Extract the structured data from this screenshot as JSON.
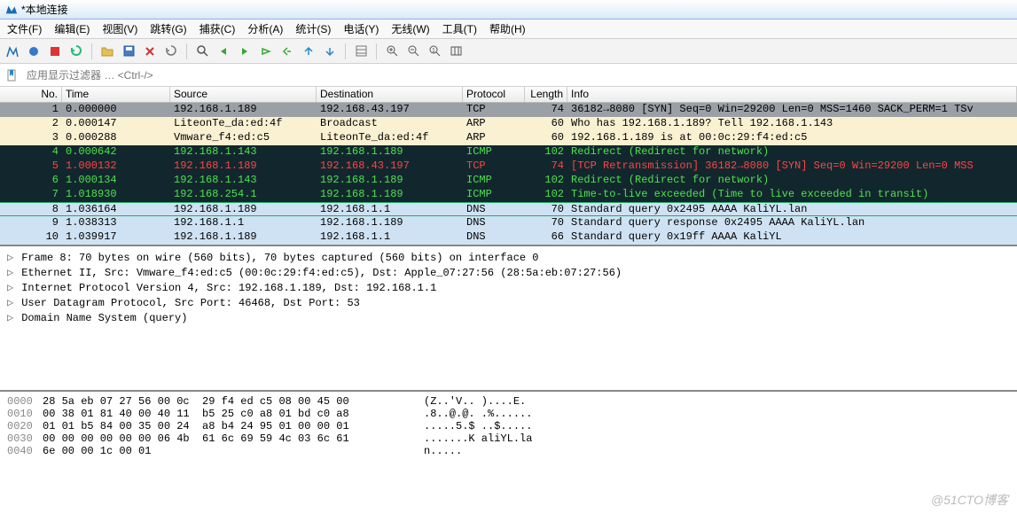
{
  "title": "*本地连接",
  "menu": [
    "文件(F)",
    "编辑(E)",
    "视图(V)",
    "跳转(G)",
    "捕获(C)",
    "分析(A)",
    "统计(S)",
    "电话(Y)",
    "无线(W)",
    "工具(T)",
    "帮助(H)"
  ],
  "filter_placeholder": "应用显示过滤器 … <Ctrl-/>",
  "columns": [
    "No.",
    "Time",
    "Source",
    "Destination",
    "Protocol",
    "Length",
    "Info"
  ],
  "packets": [
    {
      "no": "1",
      "time": "0.000000",
      "src": "192.168.1.189",
      "dst": "192.168.43.197",
      "proto": "TCP",
      "len": "74",
      "info": "36182→8080 [SYN] Seq=0 Win=29200 Len=0 MSS=1460 SACK_PERM=1 TSv",
      "bg": "#9aa0a6",
      "fg": "#000"
    },
    {
      "no": "2",
      "time": "0.000147",
      "src": "LiteonTe_da:ed:4f",
      "dst": "Broadcast",
      "proto": "ARP",
      "len": "60",
      "info": "Who has 192.168.1.189? Tell 192.168.1.143",
      "bg": "#faf0d2",
      "fg": "#000"
    },
    {
      "no": "3",
      "time": "0.000288",
      "src": "Vmware_f4:ed:c5",
      "dst": "LiteonTe_da:ed:4f",
      "proto": "ARP",
      "len": "60",
      "info": "192.168.1.189 is at 00:0c:29:f4:ed:c5",
      "bg": "#faf0d2",
      "fg": "#000"
    },
    {
      "no": "4",
      "time": "0.000642",
      "src": "192.168.1.143",
      "dst": "192.168.1.189",
      "proto": "ICMP",
      "len": "102",
      "info": "Redirect               (Redirect for network)",
      "bg": "#12272d",
      "fg": "#4de24d"
    },
    {
      "no": "5",
      "time": "1.000132",
      "src": "192.168.1.189",
      "dst": "192.168.43.197",
      "proto": "TCP",
      "len": "74",
      "info": "[TCP Retransmission] 36182→8080 [SYN] Seq=0 Win=29200 Len=0 MSS",
      "bg": "#12272d",
      "fg": "#ff4444"
    },
    {
      "no": "6",
      "time": "1.000134",
      "src": "192.168.1.143",
      "dst": "192.168.1.189",
      "proto": "ICMP",
      "len": "102",
      "info": "Redirect               (Redirect for network)",
      "bg": "#12272d",
      "fg": "#4de24d"
    },
    {
      "no": "7",
      "time": "1.018930",
      "src": "192.168.254.1",
      "dst": "192.168.1.189",
      "proto": "ICMP",
      "len": "102",
      "info": "Time-to-live exceeded  (Time to live exceeded in transit)",
      "bg": "#12272d",
      "fg": "#4de24d"
    },
    {
      "no": "8",
      "time": "1.036164",
      "src": "192.168.1.189",
      "dst": "192.168.1.1",
      "proto": "DNS",
      "len": "70",
      "info": "Standard query 0x2495 AAAA KaliYL.lan",
      "bg": "#cfe2f3",
      "fg": "#000",
      "sel": true
    },
    {
      "no": "9",
      "time": "1.038313",
      "src": "192.168.1.1",
      "dst": "192.168.1.189",
      "proto": "DNS",
      "len": "70",
      "info": "Standard query response 0x2495 AAAA KaliYL.lan",
      "bg": "#cfe2f3",
      "fg": "#000"
    },
    {
      "no": "10",
      "time": "1.039917",
      "src": "192.168.1.189",
      "dst": "192.168.1.1",
      "proto": "DNS",
      "len": "66",
      "info": "Standard query 0x19ff AAAA KaliYL",
      "bg": "#cfe2f3",
      "fg": "#000"
    }
  ],
  "details": [
    "Frame 8: 70 bytes on wire (560 bits), 70 bytes captured (560 bits) on interface 0",
    "Ethernet II, Src: Vmware_f4:ed:c5 (00:0c:29:f4:ed:c5), Dst: Apple_07:27:56 (28:5a:eb:07:27:56)",
    "Internet Protocol Version 4, Src: 192.168.1.189, Dst: 192.168.1.1",
    "User Datagram Protocol, Src Port: 46468, Dst Port: 53",
    "Domain Name System (query)"
  ],
  "hex": [
    {
      "off": "0000",
      "bytes": "28 5a eb 07 27 56 00 0c  29 f4 ed c5 08 00 45 00",
      "ascii": "(Z..'V.. )....E."
    },
    {
      "off": "0010",
      "bytes": "00 38 01 81 40 00 40 11  b5 25 c0 a8 01 bd c0 a8",
      "ascii": ".8..@.@. .%......"
    },
    {
      "off": "0020",
      "bytes": "01 01 b5 84 00 35 00 24  a8 b4 24 95 01 00 00 01",
      "ascii": ".....5.$ ..$....."
    },
    {
      "off": "0030",
      "bytes": "00 00 00 00 00 00 06 4b  61 6c 69 59 4c 03 6c 61",
      "ascii": ".......K aliYL.la"
    },
    {
      "off": "0040",
      "bytes": "6e 00 00 1c 00 01",
      "ascii": "n....."
    }
  ],
  "watermark": "@51CTO博客"
}
